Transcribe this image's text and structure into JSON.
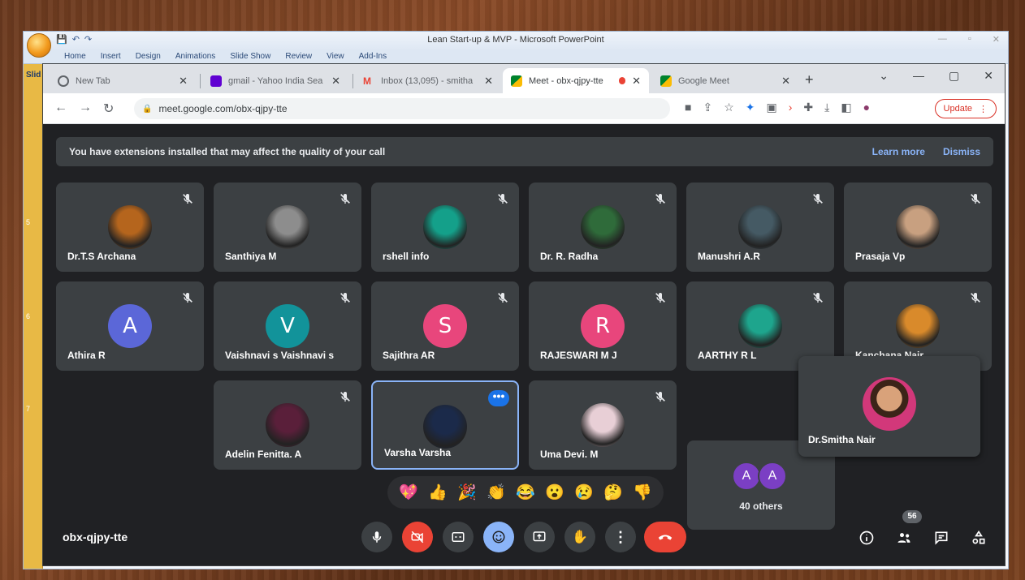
{
  "ppt": {
    "title": "Lean Start-up & MVP - Microsoft PowerPoint",
    "ribbon_tabs": [
      "Home",
      "Insert",
      "Design",
      "Animations",
      "Slide Show",
      "Review",
      "View",
      "Add-Ins"
    ],
    "side_label": "Slid",
    "slide_numbers": [
      "5",
      "6",
      "7"
    ]
  },
  "browser": {
    "tabs": [
      {
        "label": "New Tab",
        "favicon_color": "#5f6368"
      },
      {
        "label": "gmail - Yahoo India Sea",
        "favicon_color": "#6001d2"
      },
      {
        "label": "Inbox (13,095) - smitha",
        "favicon_color": "#ea4335"
      },
      {
        "label": "Meet - obx-qjpy-tte",
        "favicon_color": "#00832d"
      },
      {
        "label": "Google Meet",
        "favicon_color": "#00832d"
      }
    ],
    "url": "meet.google.com/obx-qjpy-tte",
    "update_label": "Update"
  },
  "banner": {
    "text": "You have extensions installed that may affect the quality of your call",
    "learn_more": "Learn more",
    "dismiss": "Dismiss"
  },
  "participants": [
    {
      "name": "Dr.T.S Archana",
      "avatar": "photo",
      "color": "#b5651d"
    },
    {
      "name": "Santhiya M",
      "avatar": "photo",
      "color": "#8d8d8d"
    },
    {
      "name": "rshell info",
      "avatar": "photo",
      "color": "#14a08a"
    },
    {
      "name": "Dr. R. Radha",
      "avatar": "photo",
      "color": "#2f6b3a"
    },
    {
      "name": "Manushri A.R",
      "avatar": "photo",
      "color": "#455a64"
    },
    {
      "name": "Prasaja Vp",
      "avatar": "photo",
      "color": "#c8a080"
    },
    {
      "name": "Athira R",
      "avatar": "A",
      "color": "#5b67d8"
    },
    {
      "name": "Vaishnavi s Vaishnavi s",
      "avatar": "V",
      "color": "#12939a"
    },
    {
      "name": "Sajithra AR",
      "avatar": "S",
      "color": "#e8467c"
    },
    {
      "name": "RAJESWARI M J",
      "avatar": "R",
      "color": "#e8467c"
    },
    {
      "name": "AARTHY R L",
      "avatar": "photo",
      "color": "#1ea58d"
    },
    {
      "name": "Kanchana Nair",
      "avatar": "photo",
      "color": "#d98a2b"
    },
    {
      "name": "Adelin Fenitta. A",
      "avatar": "photo",
      "color": "#5a1f3a"
    },
    {
      "name": "Varsha Varsha",
      "avatar": "photo",
      "color": "#1b2a4a"
    },
    {
      "name": "Uma Devi. M",
      "avatar": "photo",
      "color": "#e8cfd6"
    }
  ],
  "others": {
    "label": "40 others",
    "initials": [
      "A",
      "A"
    ]
  },
  "self_view": {
    "name": "Dr.Smitha Nair"
  },
  "reactions": [
    "💖",
    "👍",
    "🎉",
    "👏",
    "😂",
    "😮",
    "😢",
    "🤔",
    "👎"
  ],
  "meeting_code": "obx-qjpy-tte",
  "people_count": "56"
}
